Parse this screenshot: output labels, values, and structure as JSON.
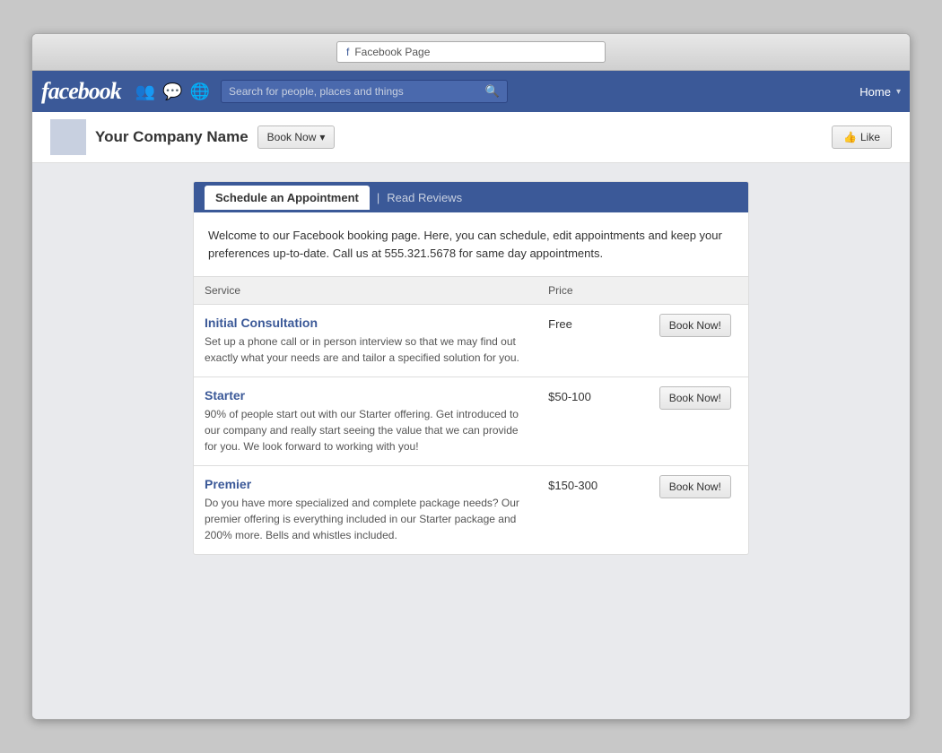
{
  "browser": {
    "address_label": "Facebook Page",
    "address_icon": "f"
  },
  "navbar": {
    "logo": "facebook",
    "search_placeholder": "Search for people, places and things",
    "home_label": "Home",
    "dropdown_arrow": "▾"
  },
  "page_header": {
    "company_name": "Your Company Name",
    "book_now_label": "Book Now",
    "like_label": "Like",
    "like_icon": "👍"
  },
  "tabs": {
    "active_label": "Schedule an Appointment",
    "separator": "|",
    "read_reviews_label": "Read Reviews"
  },
  "welcome": {
    "text": "Welcome to our Facebook booking page. Here, you can schedule, edit appointments and keep your preferences up-to-date. Call us at 555.321.5678 for same day appointments."
  },
  "table_headers": {
    "service": "Service",
    "price": "Price",
    "action": ""
  },
  "services": [
    {
      "name": "Initial Consultation",
      "description": "Set up a phone call or in person interview so that we may find out exactly what your needs are and tailor a specified solution for you.",
      "price": "Free",
      "book_label": "Book Now!"
    },
    {
      "name": "Starter",
      "description": "90% of people start out with our Starter offering. Get introduced to our company and really start seeing the value that we can provide for you. We look forward to working with you!",
      "price": "$50-100",
      "book_label": "Book Now!"
    },
    {
      "name": "Premier",
      "description": "Do you have more specialized and complete package needs? Our premier offering is everything included in our Starter package and 200% more. Bells and whistles included.",
      "price": "$150-300",
      "book_label": "Book Now!"
    }
  ]
}
